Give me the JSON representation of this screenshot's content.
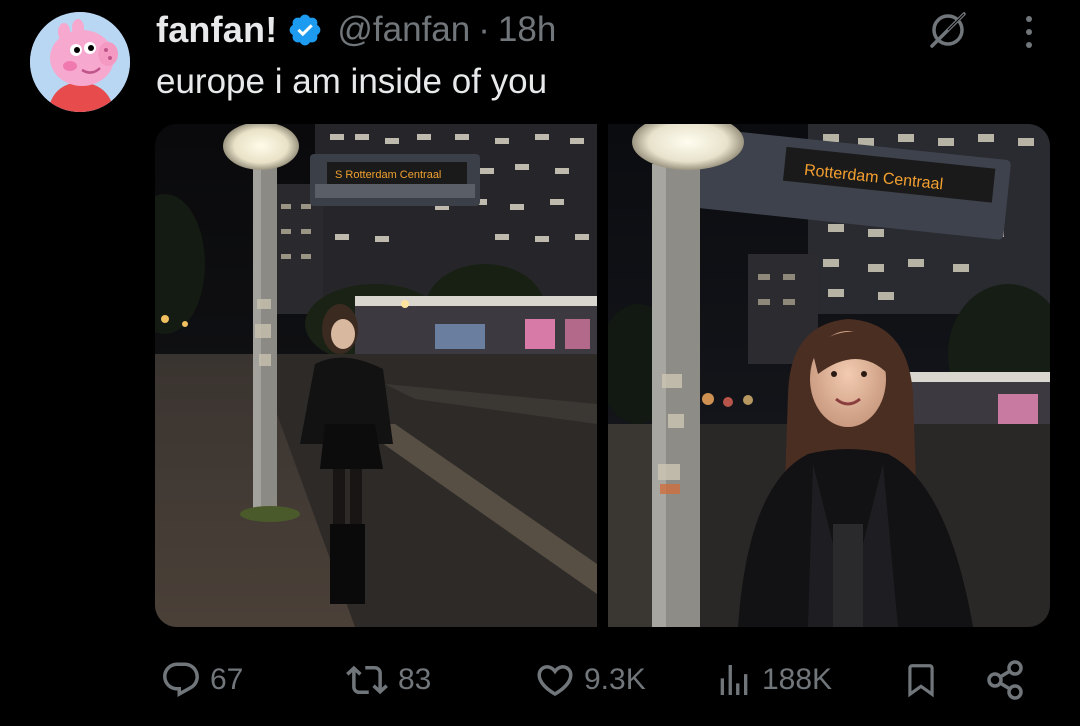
{
  "tweet": {
    "display_name": "fanfan!",
    "handle": "@fanfan",
    "separator": "·",
    "time": "18h",
    "text": "europe i am inside of you",
    "verified": true
  },
  "media": {
    "photo_count": 2,
    "sign_text_1": "S Rotterdam Centraal",
    "sign_text_2": "Rotterdam Centraal"
  },
  "actions": {
    "replies": "67",
    "reposts": "83",
    "likes": "9.3K",
    "views": "188K"
  },
  "icons": {
    "avatar": "peppa-pig-avatar",
    "verified": "verified-badge-icon",
    "grok": "grok-icon",
    "more": "more-vertical-icon",
    "reply": "reply-icon",
    "repost": "repost-icon",
    "like": "heart-icon",
    "views": "views-icon",
    "bookmark": "bookmark-icon",
    "share": "share-icon"
  },
  "colors": {
    "background": "#000000",
    "text": "#e7e9ea",
    "muted": "#71767b",
    "verified": "#1d9bf0"
  }
}
